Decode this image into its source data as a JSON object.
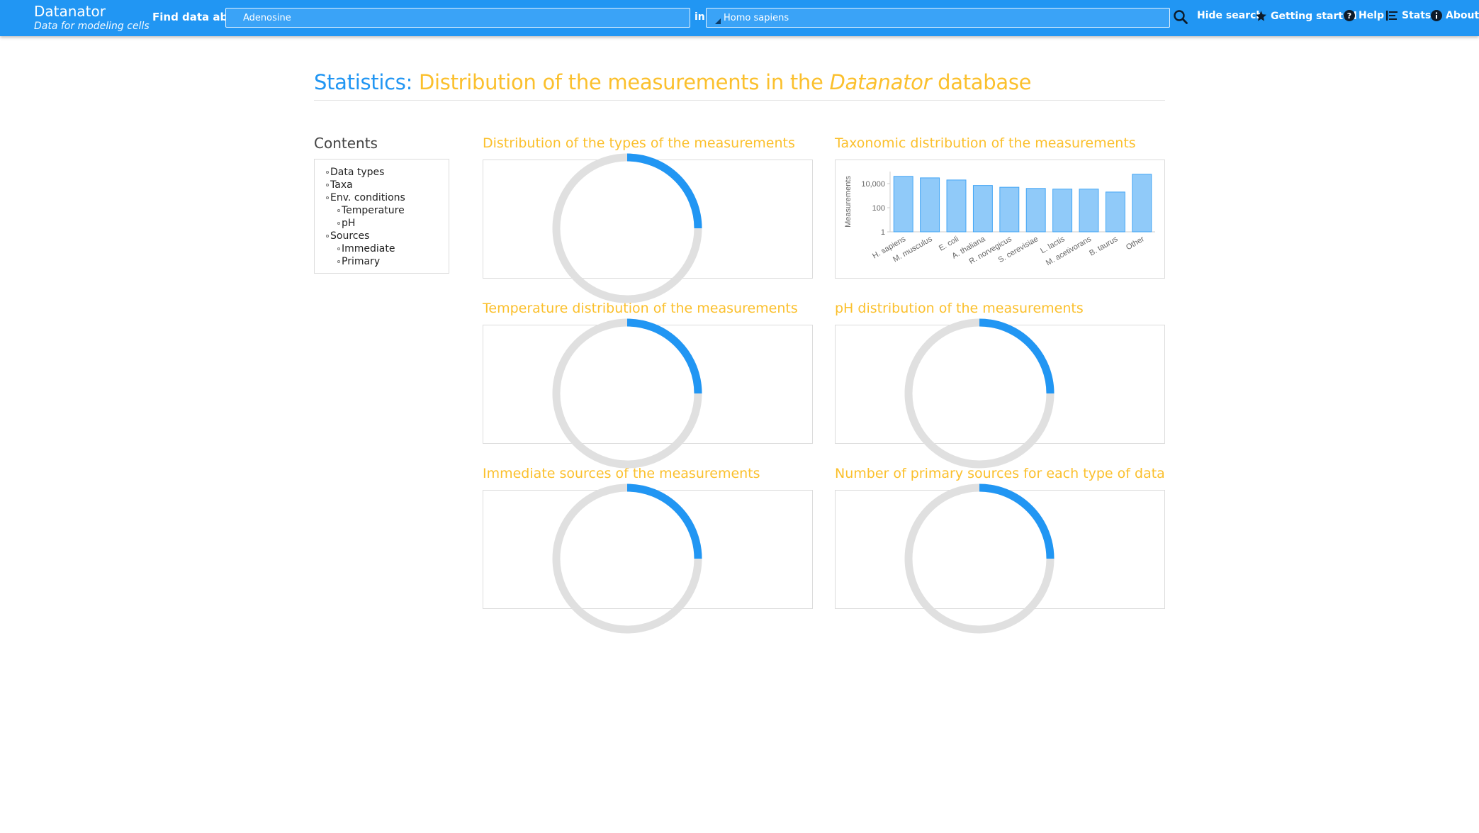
{
  "navbar": {
    "brand_title": "Datanator",
    "brand_tagline": "Data for modeling cells",
    "find_label": "Find data about",
    "query_value": "Adenosine",
    "in_label": "in",
    "organism_value": "Homo sapiens",
    "links": {
      "hide_search": "Hide search",
      "getting_started": "Getting started",
      "help": "Help",
      "stats": "Stats",
      "about": "About"
    },
    "color": "#2196f3"
  },
  "page": {
    "title_lead": "Statistics:",
    "title_main": "Distribution of the measurements in the",
    "title_emph": "Datanator",
    "title_tail": "database"
  },
  "contents": {
    "title": "Contents",
    "items": [
      {
        "label": "Data types",
        "level": 0
      },
      {
        "label": "Taxa",
        "level": 0
      },
      {
        "label": "Env. conditions",
        "level": 0
      },
      {
        "label": "Temperature",
        "level": 1
      },
      {
        "label": "pH",
        "level": 1
      },
      {
        "label": "Sources",
        "level": 0
      },
      {
        "label": "Immediate",
        "level": 1
      },
      {
        "label": "Primary",
        "level": 1
      }
    ]
  },
  "panels": {
    "types": "Distribution of the types of the measurements",
    "taxonomic": "Taxonomic distribution of the measurements",
    "temperature": "Temperature distribution of the measurements",
    "ph": "pH distribution of the measurements",
    "immediate": "Immediate sources of the measurements",
    "primary": "Number of primary sources for each type of data"
  },
  "loading_spinner": {
    "arc_fraction": 0.25,
    "arc_color": "#2196f3",
    "track_color": "#e0e0e0"
  },
  "chart_data": {
    "type": "bar",
    "ylabel": "Measurements",
    "yscale": "log",
    "yticks": [
      "1",
      "100",
      "10,000"
    ],
    "ylim": [
      1,
      100000
    ],
    "categories": [
      "H. sapiens",
      "M. musculus",
      "E. coli",
      "A. thaliana",
      "R. norvegicus",
      "S. cerevisiae",
      "L. lactis",
      "M. acetivorans",
      "B. taurus",
      "Other"
    ],
    "values": [
      40000,
      30000,
      20000,
      7000,
      5000,
      4000,
      3500,
      3500,
      2000,
      60000
    ],
    "bar_color": "#90caf9",
    "bar_stroke": "#42a5f5",
    "grid": false
  }
}
